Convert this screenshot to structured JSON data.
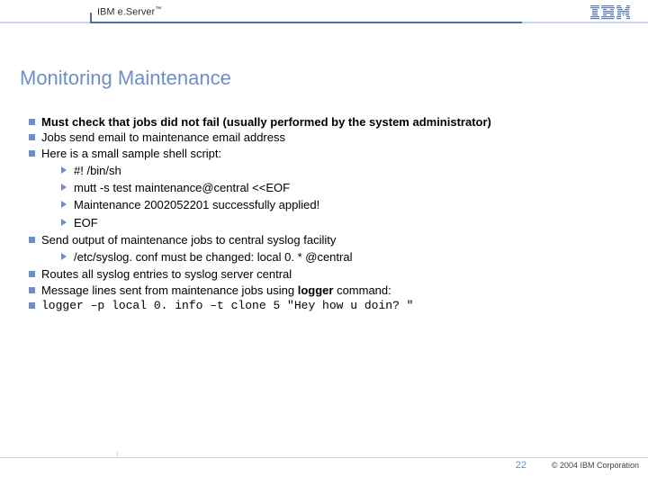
{
  "header": {
    "brand_prefix": "IBM e.",
    "brand_main": "Server",
    "brand_tm": "™"
  },
  "title": "Monitoring Maintenance",
  "bullets": {
    "b0": "Must check that jobs did not fail (usually performed by the system administrator)",
    "b1": "Jobs send email to maintenance email address",
    "b2": "Here is a small sample shell script:",
    "s0": "#! /bin/sh",
    "s1": "mutt -s test maintenance@central <<EOF",
    "s2": "Maintenance 2002052201 successfully applied!",
    "s3": "EOF",
    "b3": "Send output of maintenance jobs to central syslog facility",
    "s4": "/etc/syslog. conf must be changed:      local 0. * @central",
    "b4": "Routes all syslog entries to syslog server central",
    "b5_a": "Message lines sent from maintenance jobs using ",
    "b5_b": "logger",
    "b5_c": " command:",
    "b6": "logger –p local 0. info –t clone 5 \"Hey how u doin? \""
  },
  "footer": {
    "page": "22",
    "copyright": "© 2004 IBM Corporation"
  }
}
